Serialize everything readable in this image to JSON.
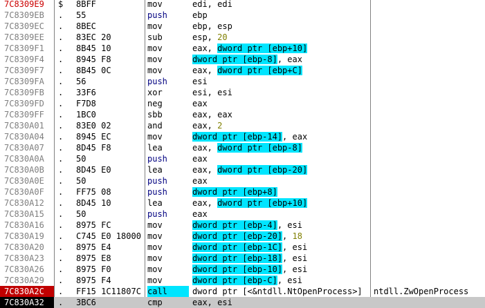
{
  "colors": {
    "operand_highlight": "#00e5ff",
    "immediate": "#808000",
    "push_mnemonic": "#000080",
    "breakpoint_bg": "#c00000",
    "eip_bg": "#000000",
    "current_line_bg": "#c8c8c8"
  },
  "rows": [
    {
      "addr": "7C8309E9",
      "marker": "$",
      "hex": "8BFF",
      "mnem": "mov",
      "ops": [
        {
          "t": "edi, edi"
        }
      ],
      "addr_red": true
    },
    {
      "addr": "7C8309EB",
      "marker": ".",
      "hex": "55",
      "mnem": "push",
      "ops": [
        {
          "t": "ebp"
        }
      ]
    },
    {
      "addr": "7C8309EC",
      "marker": ".",
      "hex": "8BEC",
      "mnem": "mov",
      "ops": [
        {
          "t": "ebp, esp"
        }
      ]
    },
    {
      "addr": "7C8309EE",
      "marker": ".",
      "hex": "83EC 20",
      "mnem": "sub",
      "ops": [
        {
          "t": "esp, "
        },
        {
          "t": "20",
          "num": true
        }
      ]
    },
    {
      "addr": "7C8309F1",
      "marker": ".",
      "hex": "8B45 10",
      "mnem": "mov",
      "ops": [
        {
          "t": "eax, "
        },
        {
          "t": "dword ptr [ebp+10]",
          "hl": true
        }
      ]
    },
    {
      "addr": "7C8309F4",
      "marker": ".",
      "hex": "8945 F8",
      "mnem": "mov",
      "ops": [
        {
          "t": "dword ptr [ebp-8]",
          "hl": true
        },
        {
          "t": ", eax"
        }
      ]
    },
    {
      "addr": "7C8309F7",
      "marker": ".",
      "hex": "8B45 0C",
      "mnem": "mov",
      "ops": [
        {
          "t": "eax, "
        },
        {
          "t": "dword ptr [ebp+C]",
          "hl": true
        }
      ]
    },
    {
      "addr": "7C8309FA",
      "marker": ".",
      "hex": "56",
      "mnem": "push",
      "ops": [
        {
          "t": "esi"
        }
      ]
    },
    {
      "addr": "7C8309FB",
      "marker": ".",
      "hex": "33F6",
      "mnem": "xor",
      "ops": [
        {
          "t": "esi, esi"
        }
      ]
    },
    {
      "addr": "7C8309FD",
      "marker": ".",
      "hex": "F7D8",
      "mnem": "neg",
      "ops": [
        {
          "t": "eax"
        }
      ]
    },
    {
      "addr": "7C8309FF",
      "marker": ".",
      "hex": "1BC0",
      "mnem": "sbb",
      "ops": [
        {
          "t": "eax, eax"
        }
      ]
    },
    {
      "addr": "7C830A01",
      "marker": ".",
      "hex": "83E0 02",
      "mnem": "and",
      "ops": [
        {
          "t": "eax, "
        },
        {
          "t": "2",
          "num": true
        }
      ]
    },
    {
      "addr": "7C830A04",
      "marker": ".",
      "hex": "8945 EC",
      "mnem": "mov",
      "ops": [
        {
          "t": "dword ptr [ebp-14]",
          "hl": true
        },
        {
          "t": ", eax"
        }
      ]
    },
    {
      "addr": "7C830A07",
      "marker": ".",
      "hex": "8D45 F8",
      "mnem": "lea",
      "ops": [
        {
          "t": "eax, "
        },
        {
          "t": "dword ptr [ebp-8]",
          "hl": true
        }
      ]
    },
    {
      "addr": "7C830A0A",
      "marker": ".",
      "hex": "50",
      "mnem": "push",
      "ops": [
        {
          "t": "eax"
        }
      ]
    },
    {
      "addr": "7C830A0B",
      "marker": ".",
      "hex": "8D45 E0",
      "mnem": "lea",
      "ops": [
        {
          "t": "eax, "
        },
        {
          "t": "dword ptr [ebp-20]",
          "hl": true
        }
      ]
    },
    {
      "addr": "7C830A0E",
      "marker": ".",
      "hex": "50",
      "mnem": "push",
      "ops": [
        {
          "t": "eax"
        }
      ]
    },
    {
      "addr": "7C830A0F",
      "marker": ".",
      "hex": "FF75 08",
      "mnem": "push",
      "ops": [
        {
          "t": "dword ptr [ebp+8]",
          "hl": true
        }
      ]
    },
    {
      "addr": "7C830A12",
      "marker": ".",
      "hex": "8D45 10",
      "mnem": "lea",
      "ops": [
        {
          "t": "eax, "
        },
        {
          "t": "dword ptr [ebp+10]",
          "hl": true
        }
      ]
    },
    {
      "addr": "7C830A15",
      "marker": ".",
      "hex": "50",
      "mnem": "push",
      "ops": [
        {
          "t": "eax"
        }
      ]
    },
    {
      "addr": "7C830A16",
      "marker": ".",
      "hex": "8975 FC",
      "mnem": "mov",
      "ops": [
        {
          "t": "dword ptr [ebp-4]",
          "hl": true
        },
        {
          "t": ", esi"
        }
      ]
    },
    {
      "addr": "7C830A19",
      "marker": ".",
      "hex": "C745 E0 18000",
      "mnem": "mov",
      "ops": [
        {
          "t": "dword ptr [ebp-20]",
          "hl": true
        },
        {
          "t": ", "
        },
        {
          "t": "18",
          "num": true
        }
      ]
    },
    {
      "addr": "7C830A20",
      "marker": ".",
      "hex": "8975 E4",
      "mnem": "mov",
      "ops": [
        {
          "t": "dword ptr [ebp-1C]",
          "hl": true
        },
        {
          "t": ", esi"
        }
      ]
    },
    {
      "addr": "7C830A23",
      "marker": ".",
      "hex": "8975 E8",
      "mnem": "mov",
      "ops": [
        {
          "t": "dword ptr [ebp-18]",
          "hl": true
        },
        {
          "t": ", esi"
        }
      ]
    },
    {
      "addr": "7C830A26",
      "marker": ".",
      "hex": "8975 F0",
      "mnem": "mov",
      "ops": [
        {
          "t": "dword ptr [ebp-10]",
          "hl": true
        },
        {
          "t": ", esi"
        }
      ]
    },
    {
      "addr": "7C830A29",
      "marker": ".",
      "hex": "8975 F4",
      "mnem": "mov",
      "ops": [
        {
          "t": "dword ptr [ebp-C]",
          "hl": true
        },
        {
          "t": ", esi"
        }
      ]
    },
    {
      "addr": "7C830A2C",
      "marker": ".",
      "hex": "FF15 1C11807C",
      "mnem": "call",
      "mnem_hl": true,
      "ops": [
        {
          "t": "dword ptr [<&ntdll.NtOpenProcess>]"
        }
      ],
      "comment": "ntdll.ZwOpenProcess",
      "breakpoint": true
    },
    {
      "addr": "7C830A32",
      "marker": ".",
      "hex": "3BC6",
      "mnem": "cmp",
      "ops": [
        {
          "t": "eax, esi"
        }
      ],
      "eip": true,
      "current": true
    }
  ]
}
